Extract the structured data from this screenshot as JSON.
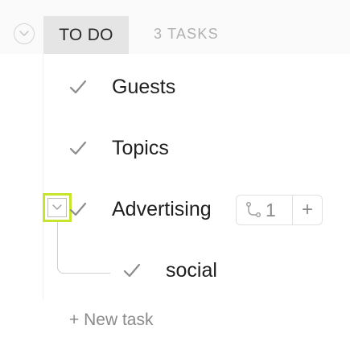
{
  "group": {
    "status_label": "TO DO",
    "task_count": "3 TASKS",
    "collapse_icon": "chevron-down-icon"
  },
  "tasks": [
    {
      "label": "Guests",
      "status_icon": "check-icon"
    },
    {
      "label": "Topics",
      "status_icon": "check-icon"
    },
    {
      "label": "Advertising",
      "status_icon": "check-icon",
      "subtask_count": "1",
      "subtask_icon": "subtask-branch-icon",
      "add_label": "+"
    }
  ],
  "subtasks": [
    {
      "label": "social",
      "status_icon": "check-icon"
    }
  ],
  "new_task_label": "+ New task",
  "colors": {
    "drag_highlight": "#c7e52e",
    "status_pill_bg": "#e5e5e5",
    "muted_text": "#8a8a8a",
    "check": "#8c8c8c"
  }
}
